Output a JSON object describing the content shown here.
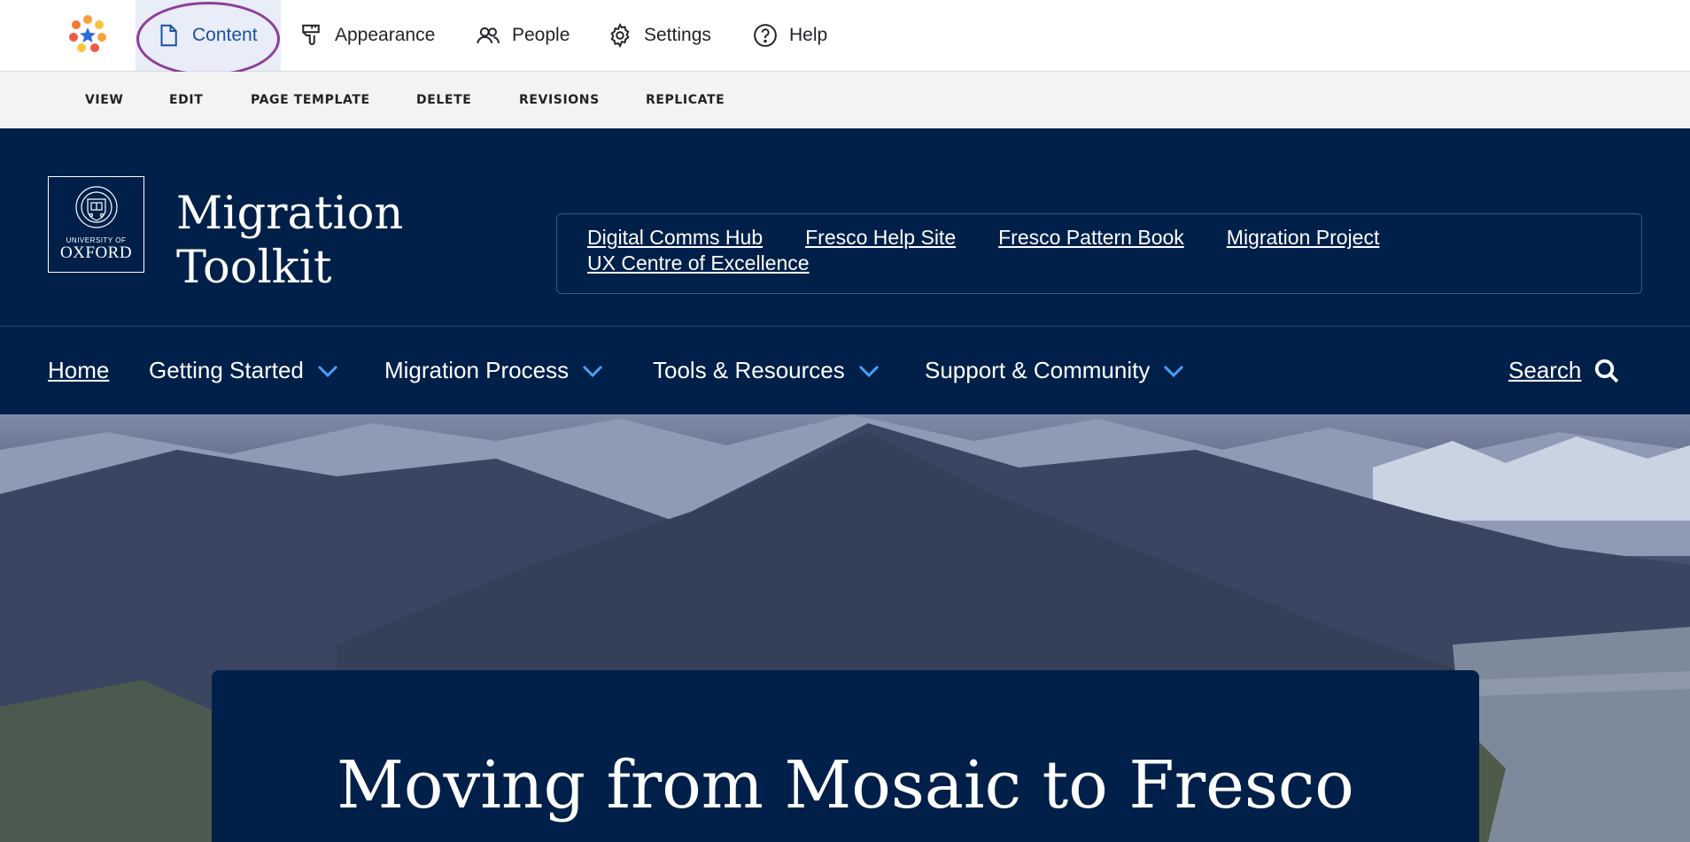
{
  "admin_toolbar": {
    "tabs": [
      {
        "label": "Content",
        "icon": "file-icon",
        "active": true
      },
      {
        "label": "Appearance",
        "icon": "brush-icon"
      },
      {
        "label": "People",
        "icon": "people-icon"
      },
      {
        "label": "Settings",
        "icon": "gear-icon"
      },
      {
        "label": "Help",
        "icon": "help-icon"
      }
    ],
    "highlight_color": "#8d3f9a"
  },
  "local_tasks": [
    "VIEW",
    "EDIT",
    "PAGE TEMPLATE",
    "DELETE",
    "REVISIONS",
    "REPLICATE"
  ],
  "site": {
    "logo": {
      "university_of": "UNIVERSITY OF",
      "oxford": "OXFORD"
    },
    "name": "Migration Toolkit",
    "quick_links": [
      "Digital Comms Hub",
      "Fresco Help Site",
      "Fresco Pattern Book",
      "Migration Project",
      "UX Centre of Excellence"
    ]
  },
  "main_nav": {
    "items": [
      {
        "label": "Home"
      },
      {
        "label": "Getting Started"
      },
      {
        "label": "Migration Process"
      },
      {
        "label": "Tools & Resources"
      },
      {
        "label": "Support & Community"
      }
    ],
    "search_label": "Search"
  },
  "hero": {
    "title": "Moving from Mosaic to Fresco"
  },
  "colors": {
    "brand_navy": "#00204a",
    "active_tab_bg": "#e8edf8",
    "active_tab_text": "#1d4fa3",
    "chevron": "#4a9ff5"
  }
}
